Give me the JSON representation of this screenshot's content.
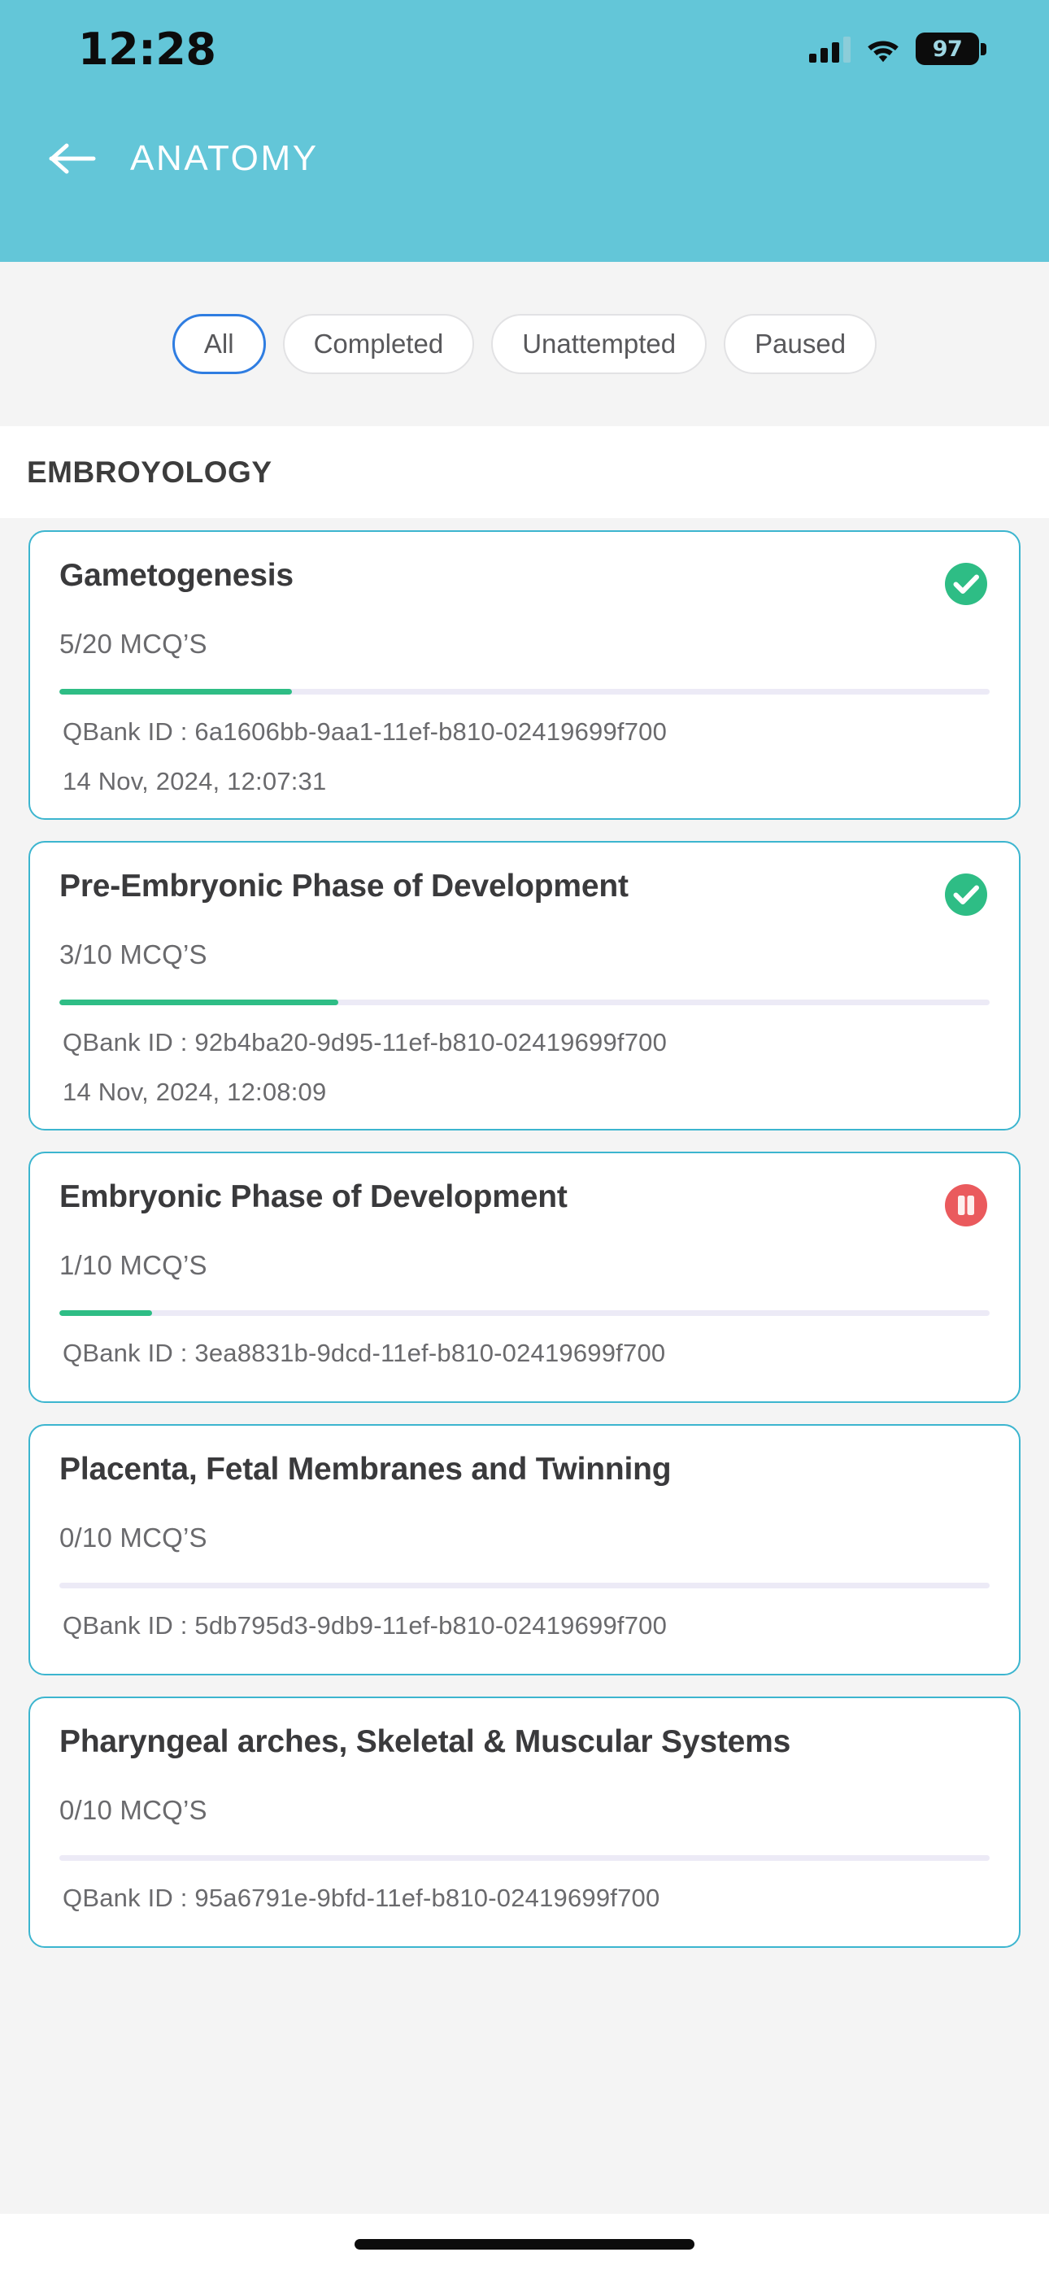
{
  "status_bar": {
    "time": "12:28",
    "battery_level": "97",
    "signal_icon": "cellular-signal-icon",
    "wifi_icon": "wifi-icon",
    "battery_icon": "battery-icon"
  },
  "app_bar": {
    "back_icon": "back-arrow-icon",
    "title": "ANATOMY",
    "background_color": "#63c6d8"
  },
  "filters": {
    "chips": [
      {
        "label": "All",
        "selected": true
      },
      {
        "label": "Completed",
        "selected": false
      },
      {
        "label": "Unattempted",
        "selected": false
      },
      {
        "label": "Paused",
        "selected": false
      }
    ],
    "selected_border_color": "#2f7de1"
  },
  "section": {
    "title": "EMBROYOLOGY"
  },
  "cards": [
    {
      "title": "Gametogenesis",
      "mcq": "5/20 MCQ’S",
      "progress_percent": 25,
      "status": "completed",
      "status_icon": "check-circle-icon",
      "qbank_label": "QBank ID : 6a1606bb-9aa1-11ef-b810-02419699f700",
      "timestamp": "14 Nov, 2024, 12:07:31"
    },
    {
      "title": "Pre-Embryonic Phase of Development",
      "mcq": "3/10 MCQ’S",
      "progress_percent": 30,
      "status": "completed",
      "status_icon": "check-circle-icon",
      "qbank_label": "QBank ID : 92b4ba20-9d95-11ef-b810-02419699f700",
      "timestamp": "14 Nov, 2024, 12:08:09"
    },
    {
      "title": "Embryonic Phase of Development",
      "mcq": "1/10 MCQ’S",
      "progress_percent": 10,
      "status": "paused",
      "status_icon": "pause-circle-icon",
      "qbank_label": "QBank ID : 3ea8831b-9dcd-11ef-b810-02419699f700",
      "timestamp": ""
    },
    {
      "title": "Placenta, Fetal Membranes and Twinning",
      "mcq": "0/10 MCQ’S",
      "progress_percent": 0,
      "status": "unattempted",
      "status_icon": "",
      "qbank_label": "QBank ID : 5db795d3-9db9-11ef-b810-02419699f700",
      "timestamp": ""
    },
    {
      "title": "Pharyngeal arches, Skeletal & Muscular Systems",
      "mcq": "0/10 MCQ’S",
      "progress_percent": 0,
      "status": "unattempted",
      "status_icon": "",
      "qbank_label": "QBank ID : 95a6791e-9bfd-11ef-b810-02419699f700",
      "timestamp": ""
    }
  ],
  "colors": {
    "header_teal": "#63c6d8",
    "card_border": "#3cb5cf",
    "progress_green": "#2ebd85",
    "progress_track": "#eceaf6",
    "status_complete": "#2ebd85",
    "status_paused": "#ea5a5d",
    "page_background": "#f4f4f4"
  },
  "home_indicator": "home-indicator"
}
